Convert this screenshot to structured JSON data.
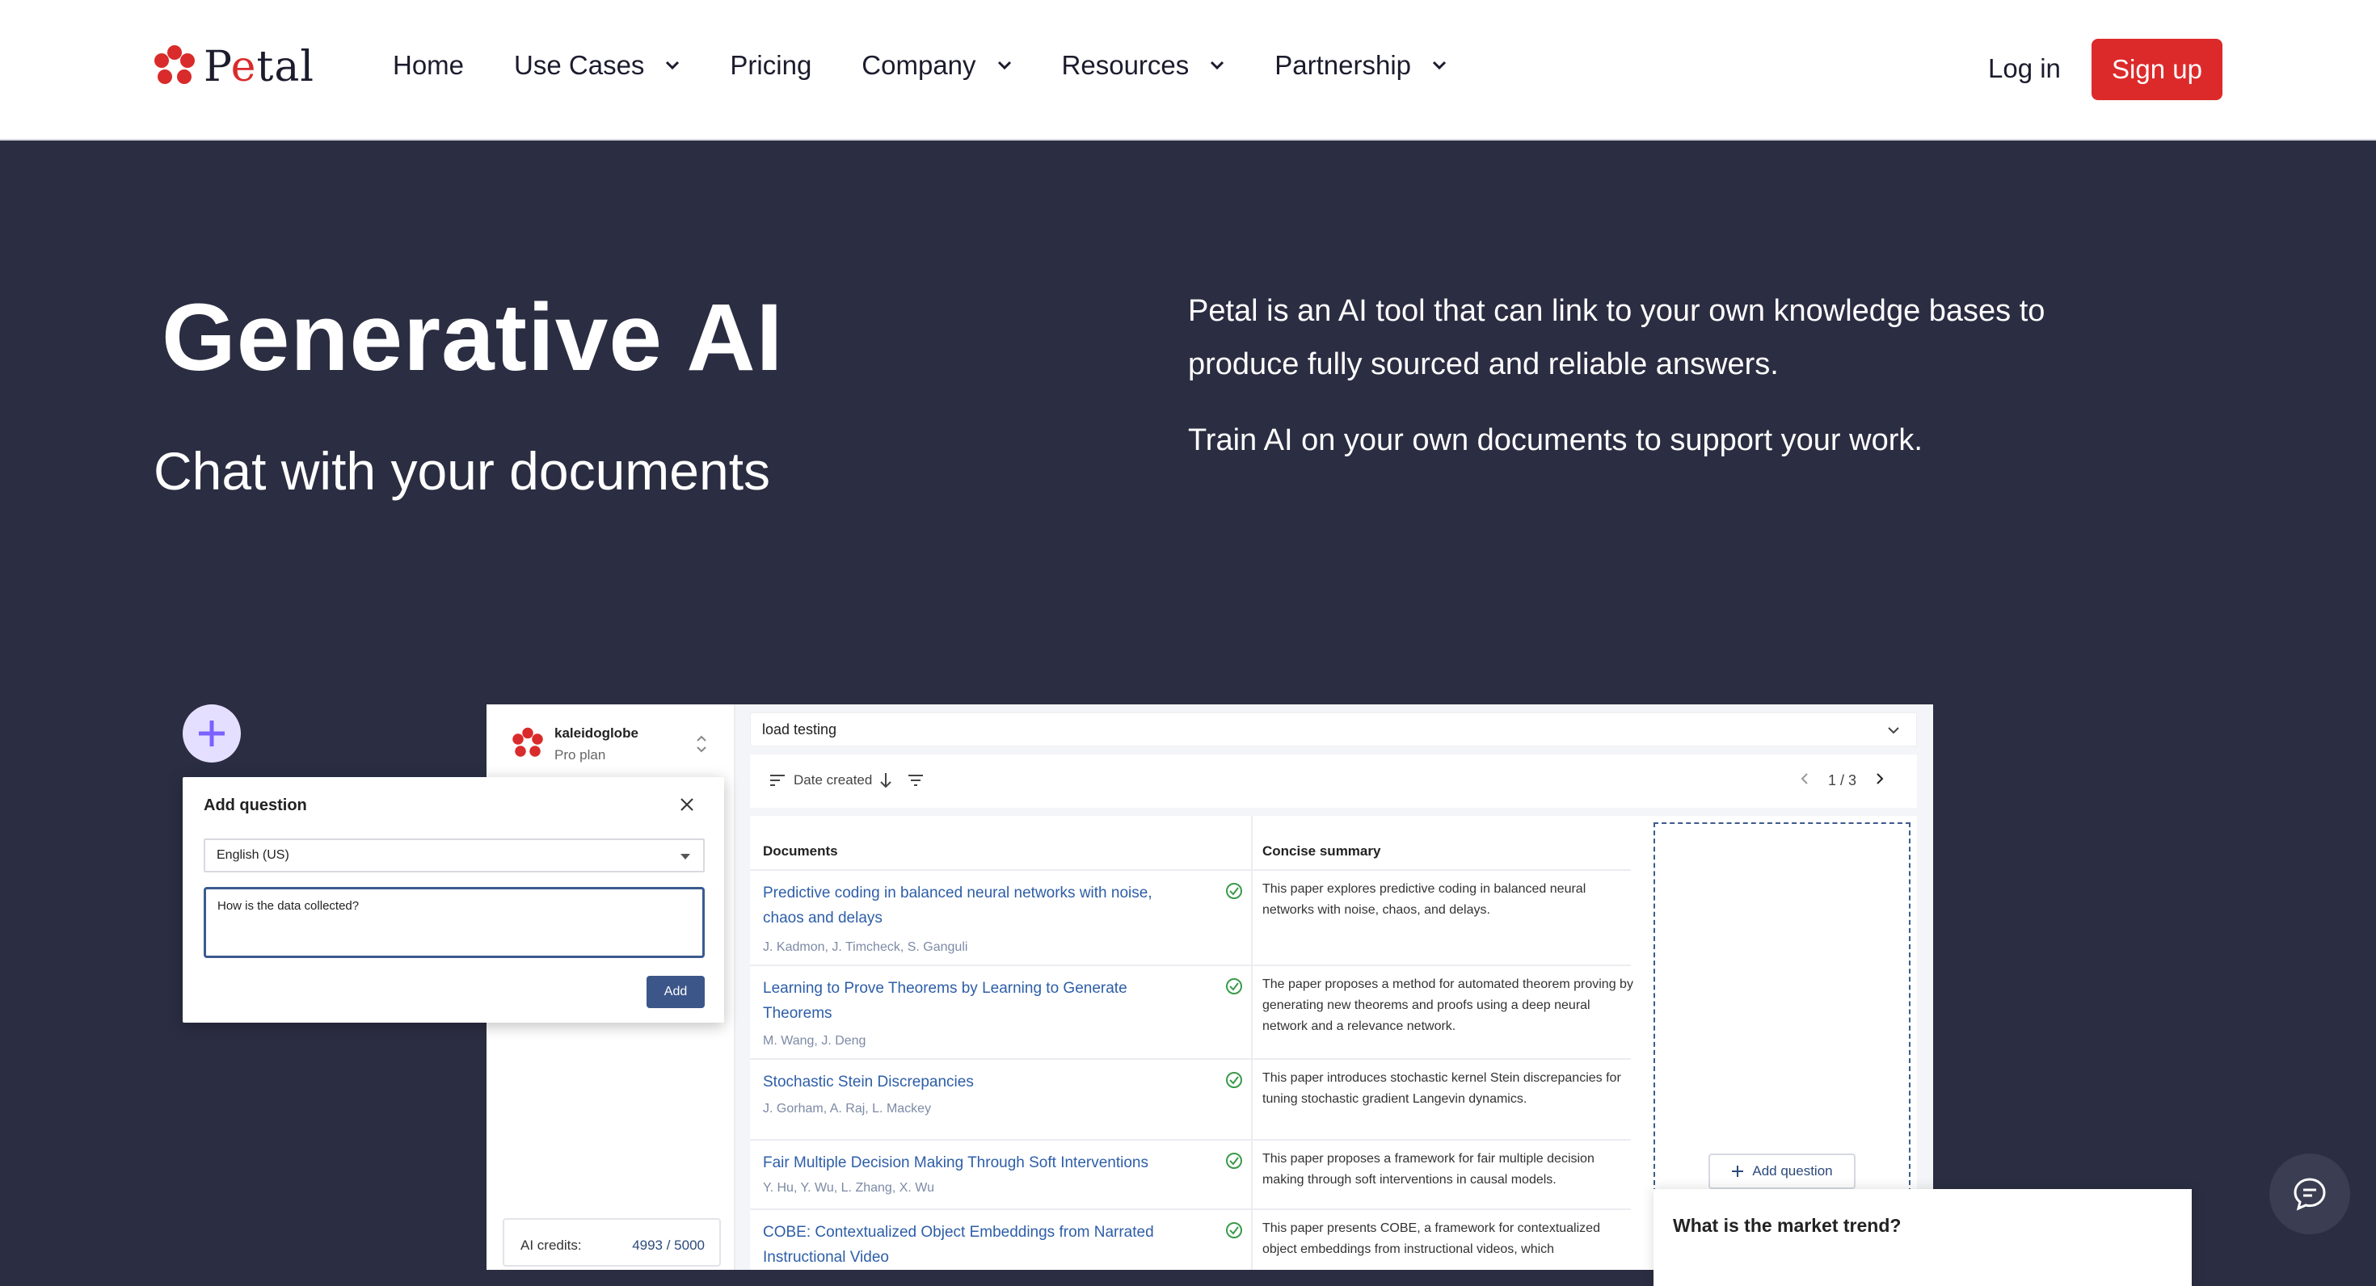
{
  "header": {
    "logo_text": "Petal",
    "nav": [
      {
        "label": "Home",
        "has_dropdown": false
      },
      {
        "label": "Use Cases",
        "has_dropdown": true
      },
      {
        "label": "Pricing",
        "has_dropdown": false
      },
      {
        "label": "Company",
        "has_dropdown": true
      },
      {
        "label": "Resources",
        "has_dropdown": true
      },
      {
        "label": "Partnership",
        "has_dropdown": true
      }
    ],
    "login_label": "Log in",
    "signup_label": "Sign up"
  },
  "hero": {
    "title": "Generative AI",
    "subtitle": "Chat with your documents",
    "description": "Petal is an AI tool that can link to your own knowledge bases to produce fully sourced and reliable answers.",
    "tagline": "Train AI on your own documents to support your work."
  },
  "app": {
    "workspace_name": "kaleidoglobe",
    "workspace_plan": "Pro plan",
    "credits_label": "AI credits:",
    "credits_value": "4993 / 5000",
    "search_value": "load testing",
    "sort_label": "Date created",
    "pager": "1 / 3",
    "columns": {
      "documents": "Documents",
      "summary": "Concise summary"
    },
    "rows": [
      {
        "title": "Predictive coding in balanced neural networks with noise, chaos and delays",
        "authors": "J. Kadmon, J. Timcheck, S. Ganguli",
        "summary": "This paper explores predictive coding in balanced neural networks with noise, chaos, and delays."
      },
      {
        "title": "Learning to Prove Theorems by Learning to Generate Theorems",
        "authors": "M. Wang, J. Deng",
        "summary": "The paper proposes a method for automated theorem proving by generating new theorems and proofs using a deep neural network and a relevance network."
      },
      {
        "title": "Stochastic Stein Discrepancies",
        "authors": "J. Gorham, A. Raj, L. Mackey",
        "summary": "This paper introduces stochastic kernel Stein discrepancies for tuning stochastic gradient Langevin dynamics."
      },
      {
        "title": "Fair Multiple Decision Making Through Soft Interventions",
        "authors": "Y. Hu, Y. Wu, L. Zhang, X. Wu",
        "summary": "This paper proposes a framework for fair multiple decision making through soft interventions in causal models."
      },
      {
        "title": "COBE: Contextualized Object Embeddings from Narrated Instructional Video",
        "authors": "",
        "summary": "This paper presents COBE, a framework for contextualized object embeddings from instructional videos, which"
      }
    ],
    "add_question_label": "Add question",
    "market_question": "What is the market trend?"
  },
  "modal": {
    "title": "Add question",
    "language": "English (US)",
    "question_value": "How is the data collected?",
    "add_label": "Add"
  },
  "colors": {
    "brand_red": "#dc2a2a",
    "hero_bg": "#2b2d42",
    "link_blue": "#2d5ea8",
    "accent_purple": "#7b61ff"
  }
}
